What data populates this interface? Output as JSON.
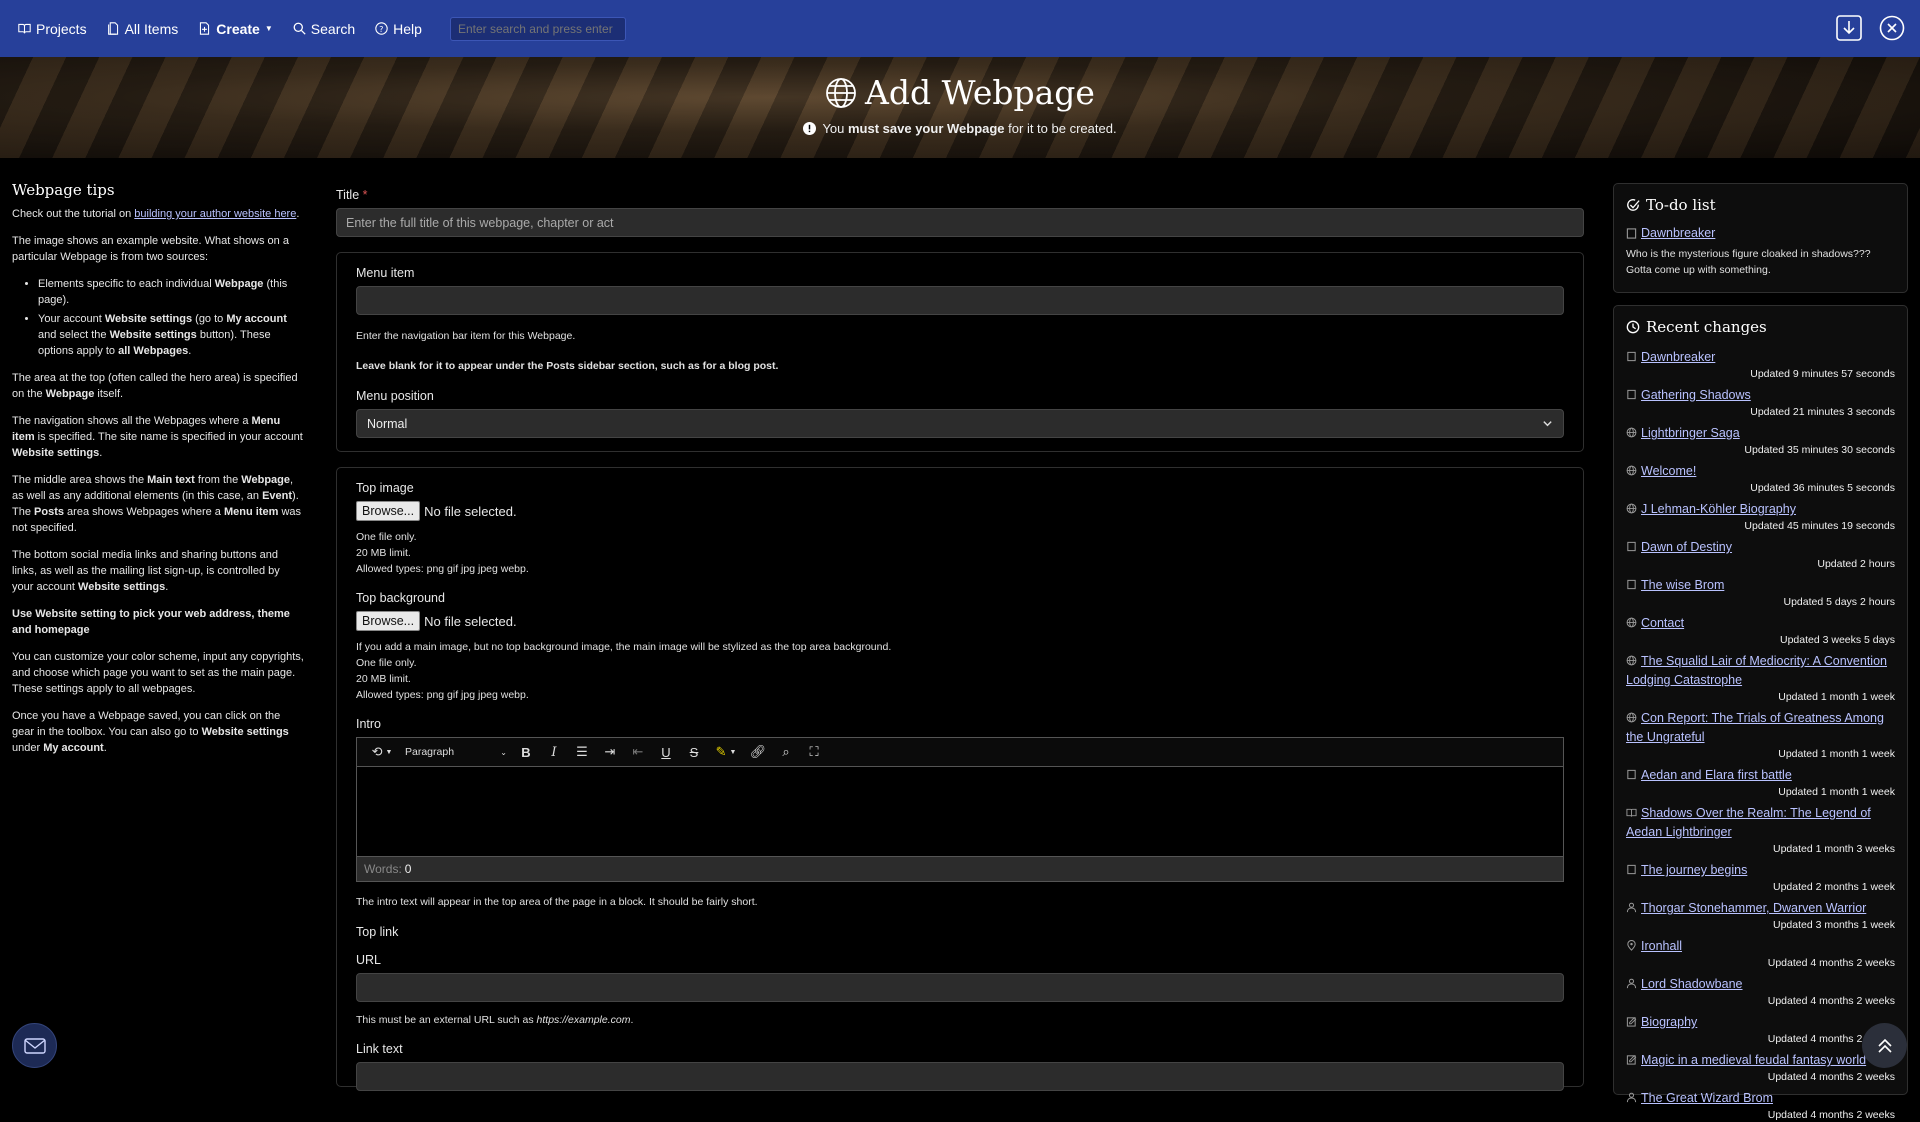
{
  "nav": {
    "projects": "Projects",
    "all_items": "All Items",
    "create": "Create",
    "search": "Search",
    "help": "Help",
    "search_placeholder": "Enter search and press enter"
  },
  "hero": {
    "title": "Add Webpage",
    "note_pre": "You ",
    "note_bold": "must save your Webpage",
    "note_post": " for it to be created."
  },
  "tips": {
    "title": "Webpage tips",
    "intro_pre": "Check out the tutorial on ",
    "intro_link": "building your author website here",
    "intro_post": ".",
    "p1": "The image shows an example website. What shows on a particular Webpage is from two sources:",
    "li1_pre": "Elements specific to each individual ",
    "li1_bold": "Webpage",
    "li1_post": " (this page).",
    "li2_a": "Your account ",
    "li2_b": "Website settings",
    "li2_c": " (go to ",
    "li2_d": "My account",
    "li2_e": " and select the ",
    "li2_f": "Website settings",
    "li2_g": " button). These options apply to ",
    "li2_h": "all Webpages",
    "li2_i": ".",
    "p2_a": "The area at the top (often called the hero area) is specified on the ",
    "p2_b": "Webpage",
    "p2_c": " itself.",
    "p3_a": "The navigation shows all the Webpages where a ",
    "p3_b": "Menu item",
    "p3_c": " is specified. The site name is specified in your account ",
    "p3_d": "Website settings",
    "p3_e": ".",
    "p4_a": "The middle area shows the ",
    "p4_b": "Main text",
    "p4_c": " from the ",
    "p4_d": "Webpage",
    "p4_e": ", as well as any additional elements (in this case, an ",
    "p4_f": "Event",
    "p4_g": "). The ",
    "p4_h": "Posts",
    "p4_i": " area shows Webpages where a ",
    "p4_j": "Menu item",
    "p4_k": " was not specified.",
    "p5_a": "The bottom social media links and sharing buttons and links, as well as the mailing list sign-up, is controlled by your account ",
    "p5_b": "Website settings",
    "p5_c": ".",
    "p6": "Use Website setting to pick your web address, theme and homepage",
    "p7": "You can customize your color scheme, input any copyrights, and choose which page you want to set as the main page. These settings apply to all webpages.",
    "p8_a": "Once you have a Webpage saved, you can click on the gear in the toolbox. You can also go to ",
    "p8_b": "Website settings",
    "p8_c": " under ",
    "p8_d": "My account",
    "p8_e": "."
  },
  "form": {
    "title_label": "Title",
    "title_required": "*",
    "title_placeholder": "Enter the full title of this webpage, chapter or act",
    "menu_item_label": "Menu item",
    "menu_item_value": "",
    "menu_item_help1": "Enter the navigation bar item for this Webpage.",
    "menu_item_help2": "Leave blank for it to appear under the Posts sidebar section, such as for a blog post.",
    "menu_position_label": "Menu position",
    "menu_position_value": "Normal",
    "top_image_label": "Top image",
    "browse": "Browse...",
    "no_file": "No file selected.",
    "top_image_help": [
      "One file only.",
      "20 MB limit.",
      "Allowed types: png gif jpg jpeg webp."
    ],
    "top_bg_label": "Top background",
    "top_bg_help": [
      "If you add a main image, but no top background image, the main image will be stylized as the top area background.",
      "One file only.",
      "20 MB limit.",
      "Allowed types: png gif jpg jpeg webp."
    ],
    "intro_label": "Intro",
    "paragraph": "Paragraph",
    "words_label": "Words:",
    "words_value": "0",
    "intro_help": "The intro text will appear in the top area of the page in a block. It should be fairly short.",
    "top_link_label": "Top link",
    "url_label": "URL",
    "url_help_pre": "This must be an external URL such as ",
    "url_help_example": "https://example.com",
    "url_help_post": ".",
    "link_text_label": "Link text"
  },
  "todo": {
    "title": "To-do list",
    "item_title": "Dawnbreaker",
    "item_note": "Who is the mysterious figure cloaked in shadows??? Gotta come up with something."
  },
  "recent": {
    "title": "Recent changes",
    "items": [
      {
        "icon": "doc-icon",
        "title": "Dawnbreaker",
        "updated": "Updated 9 minutes 57 seconds"
      },
      {
        "icon": "doc-icon",
        "title": "Gathering Shadows",
        "updated": "Updated 21 minutes 3 seconds"
      },
      {
        "icon": "globe-icon",
        "title": "Lightbringer Saga",
        "updated": "Updated 35 minutes 30 seconds"
      },
      {
        "icon": "globe-icon",
        "title": "Welcome!",
        "updated": "Updated 36 minutes 5 seconds"
      },
      {
        "icon": "globe-icon",
        "title": "J Lehman-Köhler Biography",
        "updated": "Updated 45 minutes 19 seconds"
      },
      {
        "icon": "doc-icon",
        "title": "Dawn of Destiny",
        "updated": "Updated 2 hours"
      },
      {
        "icon": "doc-icon",
        "title": "The wise Brom",
        "updated": "Updated 5 days 2 hours"
      },
      {
        "icon": "globe-icon",
        "title": "Contact",
        "updated": "Updated 3 weeks 5 days"
      },
      {
        "icon": "globe-icon",
        "title": "The Squalid Lair of Mediocrity: A Convention Lodging Catastrophe",
        "updated": "Updated 1 month 1 week"
      },
      {
        "icon": "globe-icon",
        "title": "Con Report: The Trials of Greatness Among the Ungrateful",
        "updated": "Updated 1 month 1 week"
      },
      {
        "icon": "doc-icon",
        "title": "Aedan and Elara first battle",
        "updated": "Updated 1 month 1 week"
      },
      {
        "icon": "book-icon",
        "title": "Shadows Over the Realm: The Legend of Aedan Lightbringer",
        "updated": "Updated 1 month 3 weeks"
      },
      {
        "icon": "doc-icon",
        "title": "The journey begins",
        "updated": "Updated 2 months 1 week"
      },
      {
        "icon": "person-icon",
        "title": "Thorgar Stonehammer, Dwarven Warrior",
        "updated": "Updated 3 months 1 week"
      },
      {
        "icon": "pin-icon",
        "title": "Ironhall",
        "updated": "Updated 4 months 2 weeks"
      },
      {
        "icon": "person-icon",
        "title": "Lord Shadowbane",
        "updated": "Updated 4 months 2 weeks"
      },
      {
        "icon": "note-icon",
        "title": "Biography",
        "updated": "Updated 4 months 2 weeks"
      },
      {
        "icon": "note-icon",
        "title": "Magic in a medieval feudal fantasy world",
        "updated": "Updated 4 months 2 weeks"
      },
      {
        "icon": "person-icon",
        "title": "The Great Wizard Brom",
        "updated": "Updated 4 months 2 weeks"
      }
    ]
  },
  "colors": {
    "nav": "#27409a",
    "link": "#b9c2ff",
    "field": "#2c2c2c"
  }
}
